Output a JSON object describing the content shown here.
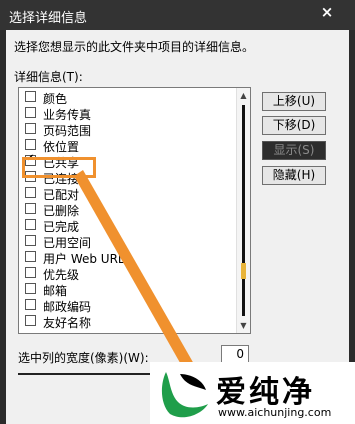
{
  "window": {
    "title": "选择详细信息",
    "close_glyph": "×"
  },
  "description": "选择您想显示的此文件夹中项目的详细信息。",
  "list_label": "详细信息(T):",
  "items": [
    {
      "label": "颜色",
      "checked": false
    },
    {
      "label": "业务传真",
      "checked": false
    },
    {
      "label": "页码范围",
      "checked": false
    },
    {
      "label": "依位置",
      "checked": false
    },
    {
      "label": "已共享",
      "checked": true
    },
    {
      "label": "已连接",
      "checked": false
    },
    {
      "label": "已配对",
      "checked": false
    },
    {
      "label": "已删除",
      "checked": false
    },
    {
      "label": "已完成",
      "checked": false
    },
    {
      "label": "已用空间",
      "checked": false
    },
    {
      "label": "用户 Web URL",
      "checked": false
    },
    {
      "label": "优先级",
      "checked": false
    },
    {
      "label": "邮箱",
      "checked": false
    },
    {
      "label": "邮政编码",
      "checked": false
    },
    {
      "label": "友好名称",
      "checked": false
    }
  ],
  "buttons": {
    "move_up": "上移(U)",
    "move_down": "下移(D)",
    "show": "显示(S)",
    "hide": "隐藏(H)"
  },
  "column_width": {
    "label": "选中列的宽度(像素)(W):",
    "value": "0"
  },
  "watermark": {
    "brand": "爱纯净",
    "url": "www.aichunjing.com"
  },
  "colors": {
    "accent": "#f0912e",
    "logo_green": "#1f9e4a",
    "scroll_thumb": "#e8b43a"
  }
}
